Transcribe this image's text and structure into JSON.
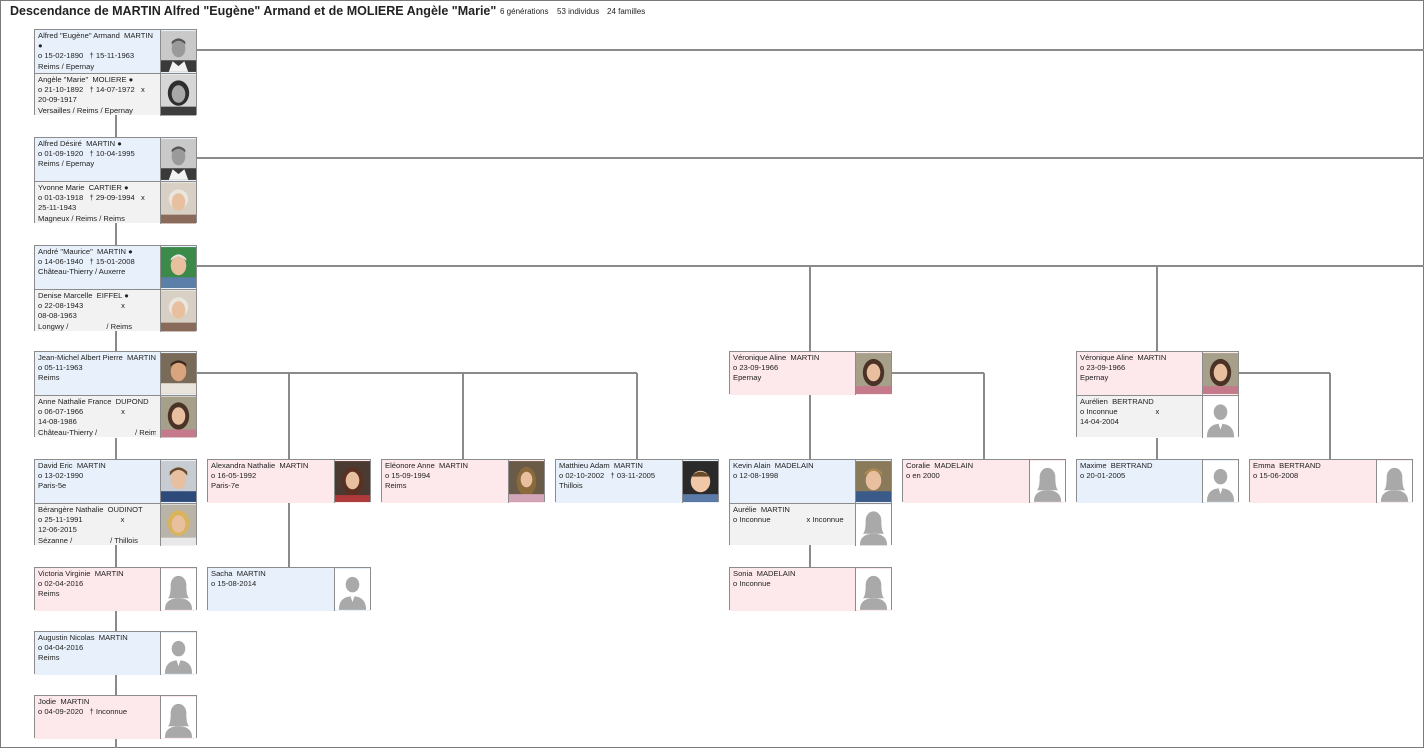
{
  "header": {
    "title": "Descendance de MARTIN Alfred \"Eugène\" Armand et de MOLIERE Angèle \"Marie\"",
    "generations": "6 générations",
    "individuals": "53 individus",
    "families": "24 familles"
  },
  "persons": [
    {
      "id": "alfred_eugene",
      "name": "Alfred \"Eugène\" Armand  MARTIN\n●",
      "l1": "o 15-02-1890   † 15-11-1963",
      "l2": "Reims / Epernay",
      "sex": "m",
      "photo": "bw-man"
    },
    {
      "id": "angele",
      "name": "Angèle \"Marie\"  MOLIERE ●",
      "l1": "o 21-10-1892   † 14-07-1972   x\n20-09-1917",
      "l2": "Versailles / Reims / Epernay",
      "sex": "s",
      "photo": "bw-woman"
    },
    {
      "id": "alfred_desire",
      "name": "Alfred Désiré  MARTIN ●",
      "l1": "o 01-09-1920   † 10-04-1995",
      "l2": "Reims / Epernay",
      "sex": "m",
      "photo": "bw-man"
    },
    {
      "id": "yvonne",
      "name": "Yvonne Marie  CARTIER ●",
      "l1": "o 01-03-1918   † 29-09-1994   x\n25-11-1943",
      "l2": "Magneux / Reims / Reims",
      "sex": "s",
      "photo": "old-woman"
    },
    {
      "id": "andre",
      "name": "André \"Maurice\"  MARTIN ●",
      "l1": "o 14-06-1940   † 15-01-2008",
      "l2": "Château-Thierry / Auxerre",
      "sex": "m",
      "photo": "old-man"
    },
    {
      "id": "denise",
      "name": "Denise Marcelle  EIFFEL ●",
      "l1": "o 22-08-1943                  x\n08-08-1963",
      "l2": "Longwy /                  / Reims",
      "sex": "s",
      "photo": "old-woman"
    },
    {
      "id": "jeanmichel",
      "name": "Jean-Michel Albert Pierre  MARTIN",
      "l1": "o 05-11-1963",
      "l2": "Reims",
      "sex": "m",
      "photo": "man"
    },
    {
      "id": "anne",
      "name": "Anne Nathalie France  DUPOND",
      "l1": "o 06-07-1966                  x\n14-08-1986",
      "l2": "Château-Thierry /                  / Reims",
      "sex": "s",
      "photo": "woman"
    },
    {
      "id": "david",
      "name": "David Eric  MARTIN",
      "l1": "o 13-02-1990",
      "l2": "Paris-5e",
      "sex": "m",
      "photo": "young-man"
    },
    {
      "id": "berangere",
      "name": "Bérangère Nathalie  OUDINOT",
      "l1": "o 25-11-1991                  x\n12-06-2015",
      "l2": "Sézanne /                  / Thillois",
      "sex": "s",
      "photo": "blonde"
    },
    {
      "id": "victoria",
      "name": "Victoria Virginie  MARTIN",
      "l1": "o 02-04-2016",
      "l2": "Reims",
      "sex": "f",
      "photo": "sil-f"
    },
    {
      "id": "augustin",
      "name": "Augustin Nicolas  MARTIN",
      "l1": "o 04-04-2016",
      "l2": "Reims",
      "sex": "m",
      "photo": "sil-m"
    },
    {
      "id": "jodie",
      "name": "Jodie  MARTIN",
      "l1": "o 04-09-2020   † Inconnue",
      "l2": "",
      "sex": "f",
      "photo": "sil-f"
    },
    {
      "id": "alexandra",
      "name": "Alexandra Nathalie  MARTIN",
      "l1": "o 16-05-1992",
      "l2": "Paris-7e",
      "sex": "f",
      "photo": "young-woman"
    },
    {
      "id": "sacha",
      "name": "Sacha  MARTIN",
      "l1": "o 15-08-2014",
      "l2": "",
      "sex": "m",
      "photo": "sil-m"
    },
    {
      "id": "eleonore",
      "name": "Eléonore Anne  MARTIN",
      "l1": "o 15-09-1994",
      "l2": "Reims",
      "sex": "f",
      "photo": "girl"
    },
    {
      "id": "matthieu",
      "name": "Matthieu Adam  MARTIN",
      "l1": "o 02-10-2002   † 03-11-2005",
      "l2": "Thillois",
      "sex": "m",
      "photo": "baby"
    },
    {
      "id": "veronique1",
      "name": "Véronique Aline  MARTIN",
      "l1": "o 23-09-1966",
      "l2": "Epernay",
      "sex": "f",
      "photo": "woman"
    },
    {
      "id": "kevin",
      "name": "Kevin Alain  MADELAIN",
      "l1": "o 12-08-1998",
      "l2": "",
      "sex": "m",
      "photo": "boy"
    },
    {
      "id": "aurelie",
      "name": "Aurélie  MARTIN",
      "l1": "o Inconnue                 x Inconnue",
      "l2": "",
      "sex": "s",
      "photo": "sil-f"
    },
    {
      "id": "sonia",
      "name": "Sonia  MADELAIN",
      "l1": "o Inconnue",
      "l2": "",
      "sex": "f",
      "photo": "sil-f"
    },
    {
      "id": "coralie",
      "name": "Coralie  MADELAIN",
      "l1": "o en 2000",
      "l2": "",
      "sex": "f",
      "photo": "sil-f"
    },
    {
      "id": "veronique2",
      "name": "Véronique Aline  MARTIN",
      "l1": "o 23-09-1966",
      "l2": "Epernay",
      "sex": "f",
      "photo": "woman"
    },
    {
      "id": "aurelien",
      "name": "Aurélien  BERTRAND",
      "l1": "o Inconnue                  x\n14-04-2004",
      "l2": "",
      "sex": "s",
      "photo": "sil-m"
    },
    {
      "id": "maxime",
      "name": "Maxime  BERTRAND",
      "l1": "o 20-01-2005",
      "l2": "",
      "sex": "m",
      "photo": "sil-m"
    },
    {
      "id": "emma",
      "name": "Emma  BERTRAND",
      "l1": "o 15-06-2008",
      "l2": "",
      "sex": "f",
      "photo": "sil-f"
    }
  ]
}
